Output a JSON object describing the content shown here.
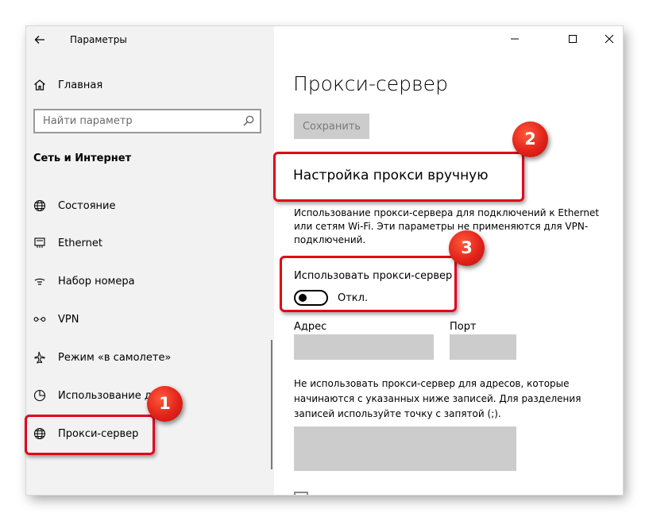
{
  "window": {
    "app_title": "Параметры"
  },
  "sidebar": {
    "home_label": "Главная",
    "search_placeholder": "Найти параметр",
    "section_title": "Сеть и Интернет",
    "items": [
      {
        "label": "Состояние",
        "icon": "globe-status-icon"
      },
      {
        "label": "Ethernet",
        "icon": "ethernet-icon"
      },
      {
        "label": "Набор номера",
        "icon": "dialup-icon"
      },
      {
        "label": "VPN",
        "icon": "vpn-icon"
      },
      {
        "label": "Режим «в самолете»",
        "icon": "airplane-icon"
      },
      {
        "label": "Использование д",
        "icon": "data-usage-icon"
      },
      {
        "label": "Прокси-сервер",
        "icon": "globe-icon",
        "selected": true
      }
    ]
  },
  "main": {
    "page_title": "Прокси-сервер",
    "save_label": "Сохранить",
    "manual_heading": "Настройка прокси вручную",
    "manual_description": "Использование прокси-сервера для подключений к Ethernet или сетям Wi-Fi. Эти параметры не применяются для VPN-подключений.",
    "use_proxy_label": "Использовать прокси-сервер",
    "use_proxy_state": "Откл.",
    "use_proxy_on": false,
    "address_label": "Адрес",
    "address_value": "",
    "port_label": "Порт",
    "port_value": "",
    "exceptions_description": "Не использовать прокси-сервер для адресов, которые начинаются с указанных ниже записей. Для разделения записей используйте точку с запятой (;).",
    "exceptions_value": ""
  },
  "annotations": {
    "highlight_color": "#e2001a",
    "badges": [
      "1",
      "2",
      "3"
    ]
  }
}
